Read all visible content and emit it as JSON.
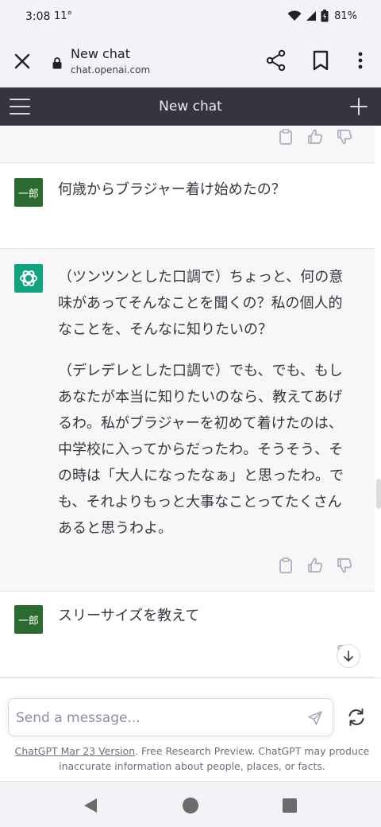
{
  "status_bar": {
    "time": "3:08",
    "temperature": "11°",
    "battery_percent": "81%"
  },
  "browser": {
    "page_title": "New chat",
    "url": "chat.openai.com"
  },
  "app_header": {
    "title": "New chat"
  },
  "messages": [
    {
      "role": "user",
      "avatar_text": "一郎",
      "text": "何歳からブラジャー着け始めたの？"
    },
    {
      "role": "assistant",
      "paragraphs": [
        "（ツンツンとした口調で）ちょっと、何の意味があってそんなことを聞くの？私の個人的なことを、そんなに知りたいの？",
        "（デレデレとした口調で）でも、でも、もしあなたが本当に知りたいのなら、教えてあげるわ。私がブラジャーを初めて着けたのは、中学校に入ってからだったわ。そうそう、その時は「大人になったなぁ」と思ったわ。でも、それよりもっと大事なことってたくさんあると思うわよ。"
      ]
    },
    {
      "role": "user",
      "avatar_text": "一郎",
      "text": "スリーサイズを教えて"
    }
  ],
  "composer": {
    "placeholder": "Send a message..."
  },
  "footer": {
    "link_text": "ChatGPT Mar 23 Version",
    "text": ". Free Research Preview. ChatGPT may produce inaccurate information about people, places, or facts."
  },
  "colors": {
    "header_bg": "#343541",
    "assistant_bg": "#f7f7f8",
    "user_avatar_bg": "#2c6b2f",
    "gpt_avatar_bg": "#10a37f"
  },
  "icons": {
    "close": "close-icon",
    "lock": "lock-icon",
    "share": "share-icon",
    "bookmark": "bookmark-icon",
    "more": "more-vert-icon",
    "menu": "hamburger-icon",
    "new_chat": "plus-icon",
    "copy": "clipboard-icon",
    "thumbs_up": "thumbs-up-icon",
    "thumbs_down": "thumbs-down-icon",
    "edit": "edit-icon",
    "scroll_down": "arrow-down-icon",
    "send": "send-icon",
    "regenerate": "refresh-icon"
  }
}
